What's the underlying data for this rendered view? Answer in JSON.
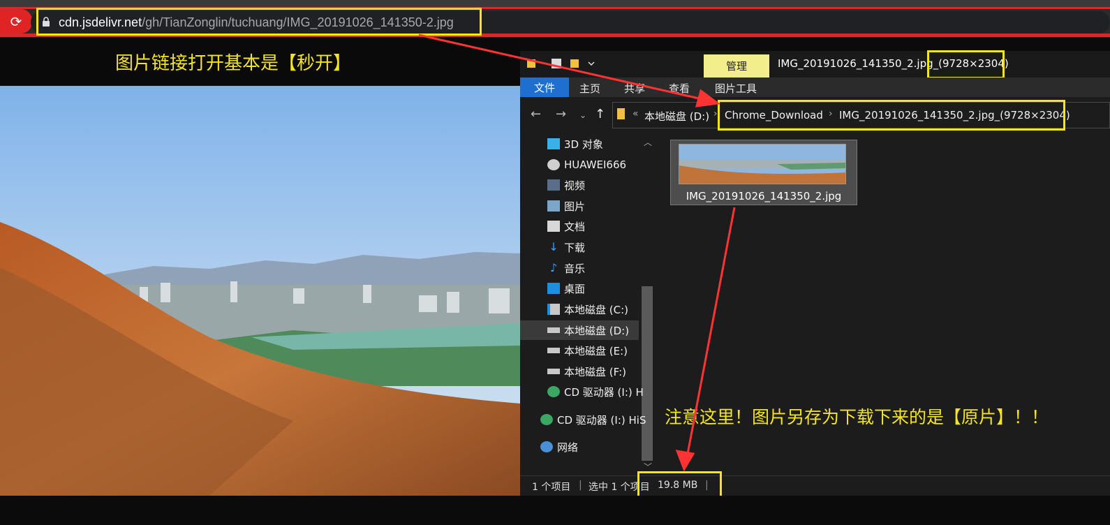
{
  "browser": {
    "url_host": "cdn.jsdelivr.net",
    "url_path": "/gh/TianZonglin/tuchuang/IMG_20191026_141350-2.jpg"
  },
  "annotations": {
    "caption_top": "图片链接打开基本是【秒开】",
    "caption_bottom": "注意这里！图片另存为下载下来的是【原片】！！",
    "highlight_color": "#f5e51b",
    "arrow_color": "#ff3333"
  },
  "explorer": {
    "ribbon_tabs": [
      "文件",
      "主页",
      "共享",
      "查看"
    ],
    "manage_label": "管理",
    "image_tools_label": "图片工具",
    "window_title": "IMG_20191026_141350_2.jpg_",
    "window_title_dims": "(9728×2304)",
    "breadcrumb": {
      "prefix": "«",
      "drive": "本地磁盘 (D:)",
      "folder": "Chrome_Download",
      "current": "IMG_20191026_141350_2.jpg_(9728×2304)"
    },
    "sidebar": [
      {
        "label": "3D 对象",
        "icon": "3d-objects-icon"
      },
      {
        "label": "HUAWEI666",
        "icon": "network-drive-icon"
      },
      {
        "label": "视频",
        "icon": "video-icon"
      },
      {
        "label": "图片",
        "icon": "pictures-icon"
      },
      {
        "label": "文档",
        "icon": "documents-icon"
      },
      {
        "label": "下载",
        "icon": "download-icon"
      },
      {
        "label": "音乐",
        "icon": "music-icon"
      },
      {
        "label": "桌面",
        "icon": "desktop-icon"
      },
      {
        "label": "本地磁盘 (C:)",
        "icon": "windows-drive-icon"
      },
      {
        "label": "本地磁盘 (D:)",
        "icon": "drive-icon"
      },
      {
        "label": "本地磁盘 (E:)",
        "icon": "drive-icon"
      },
      {
        "label": "本地磁盘 (F:)",
        "icon": "drive-icon"
      },
      {
        "label": "CD 驱动器 (I:) H",
        "icon": "cd-drive-icon"
      },
      {
        "label": "CD 驱动器 (I:) HiS",
        "icon": "cd-drive-icon"
      },
      {
        "label": "网络",
        "icon": "network-icon"
      }
    ],
    "selected_sidebar_item": "本地磁盘 (D:)",
    "file": {
      "name": "IMG_20191026_141350_2.jpg"
    },
    "status": {
      "items": "1 个项目",
      "selected": "选中 1 个项目",
      "size": "19.8 MB"
    }
  }
}
